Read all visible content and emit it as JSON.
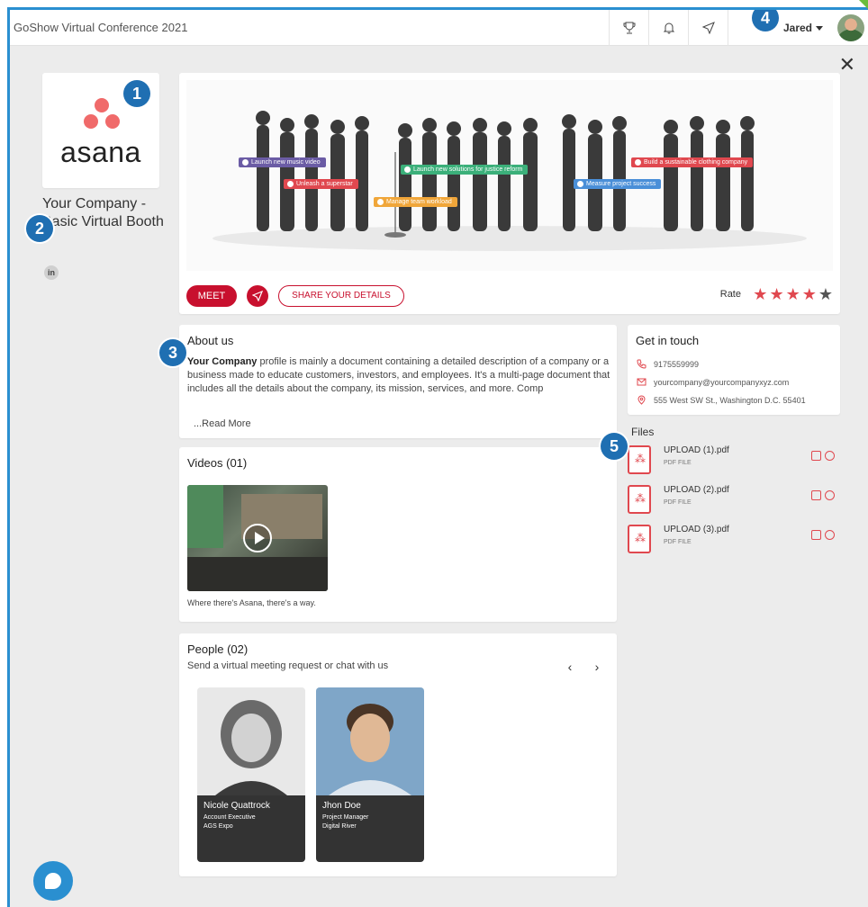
{
  "topbar": {
    "title": "GoShow Virtual Conference 2021",
    "user_name": "Jared"
  },
  "booth": {
    "logo_text": "asana",
    "company_name": "Your Company - Basic Virtual Booth",
    "linkedin": "in"
  },
  "banner": {
    "tags": [
      {
        "label": "Launch new music video",
        "color": "#6b5ca5"
      },
      {
        "label": "Unleash a superstar",
        "color": "#e0484f"
      },
      {
        "label": "Manage team workload",
        "color": "#f0a63a"
      },
      {
        "label": "Launch new solutions for justice reform",
        "color": "#3bb07a"
      },
      {
        "label": "Measure project success",
        "color": "#4a8fd8"
      },
      {
        "label": "Build a sustainable clothing company",
        "color": "#e0484f"
      }
    ]
  },
  "actions": {
    "meet": "MEET",
    "share": "SHARE YOUR DETAILS",
    "rate_label": "Rate",
    "rating": 4,
    "rating_max": 5
  },
  "about": {
    "title": "About us",
    "bold_lead": "Your Company",
    "text": " profile is mainly a document containing a detailed description of a company or a business made to educate customers, investors, and employees. It's a multi-page document that includes all the details about the company, its mission, services, and more. Comp",
    "read_more": "...Read More"
  },
  "contact": {
    "title": "Get in touch",
    "phone": "9175559999",
    "email": "yourcompany@yourcompanyxyz.com",
    "address": "555 West SW St., Washington D.C. 55401"
  },
  "files": {
    "title": "Files",
    "items": [
      {
        "name": "UPLOAD (1).pdf",
        "type": "PDF FILE"
      },
      {
        "name": "UPLOAD (2).pdf",
        "type": "PDF FILE"
      },
      {
        "name": "UPLOAD (3).pdf",
        "type": "PDF FILE"
      }
    ]
  },
  "videos": {
    "title": "Videos (01)",
    "caption": "Where there's Asana, there's a way."
  },
  "people": {
    "title": "People (02)",
    "subtitle": "Send a virtual meeting request or chat with us",
    "prev": "‹",
    "next": "›",
    "items": [
      {
        "name": "Nicole Quattrock",
        "role": "Account Executive",
        "company": "AGS Expo"
      },
      {
        "name": "Jhon Doe",
        "role": "Project Manager",
        "company": "Digital River"
      }
    ]
  },
  "markers": [
    "1",
    "2",
    "3",
    "4",
    "5"
  ],
  "colors": {
    "accent": "#c8102e",
    "frame": "#2a8fd0",
    "marker": "#1f6fb2",
    "star_on": "#e0484f",
    "star_off": "#555555"
  }
}
